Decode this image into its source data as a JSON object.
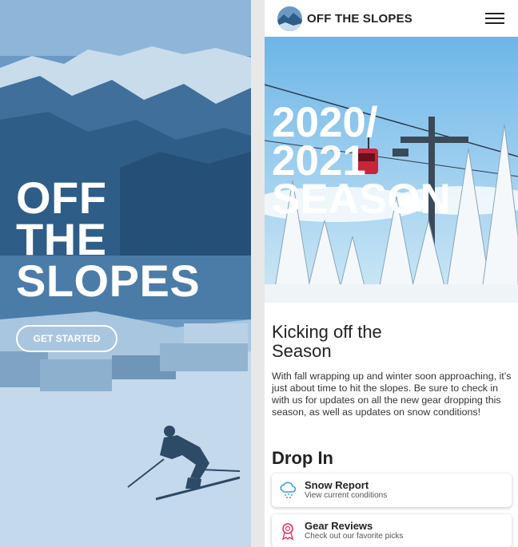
{
  "landing": {
    "title_lines": [
      "OFF",
      "THE",
      "SLOPES"
    ],
    "cta_label": "GET STARTED"
  },
  "header": {
    "brand": "OFF THE SLOPES",
    "menu_icon": "hamburger-menu-icon"
  },
  "banner": {
    "title_lines": [
      "2020/",
      "2021",
      "SEASON"
    ]
  },
  "article": {
    "heading": "Kicking off the Season",
    "body": "With fall wrapping up and winter soon approaching, it’s just about time to hit the slopes. Be sure to check in with us for updates on all the new gear dropping this season, as well as updates on snow conditions!"
  },
  "drop_in": {
    "title": "Drop In",
    "cards": [
      {
        "icon": "snow-cloud-icon",
        "title": "Snow Report",
        "subtitle": "View current conditions",
        "icon_color": "#3aa0d8"
      },
      {
        "icon": "award-ribbon-icon",
        "title": "Gear Reviews",
        "subtitle": "Check out our favorite picks",
        "icon_color": "#e0345c"
      }
    ]
  },
  "colors": {
    "overlay_blue": "#5d8fbb",
    "sky_blue": "#7fc0ea",
    "gondola_red": "#c8243a"
  }
}
